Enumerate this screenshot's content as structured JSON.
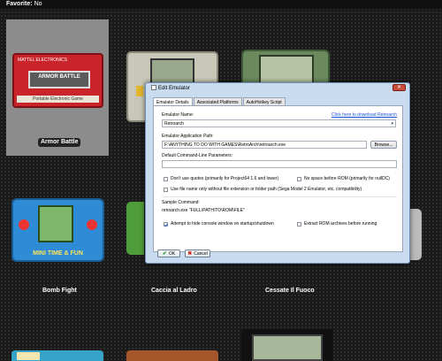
{
  "header": {
    "label": "Favorite:",
    "value": "No"
  },
  "games": {
    "selected": {
      "title": "Armor Battle",
      "artwork_brand": "MATTEL ELECTRONICS",
      "artwork_screen": "ARMOR BATTLE",
      "artwork_strip": "Portable Electronic Game"
    },
    "row2": [
      {
        "title": "Bomb Fight",
        "artwork_label": "MINI TIME & FUN"
      },
      {
        "title": "Caccia al Ladro"
      },
      {
        "title": "Cessate Il Fuoco"
      }
    ]
  },
  "dialog": {
    "title": "Edit Emulator",
    "close_label": "✕",
    "tabs": [
      "Emulator Details",
      "Associated Platforms",
      "AutoHotkey Script"
    ],
    "emulator_name_label": "Emulator Name:",
    "download_link": "Click here to download Retroarch",
    "emulator_name_value": "Retroarch",
    "app_path_label": "Emulator Application Path:",
    "app_path_value": "F:\\ANYTHING TO DO WITH GAMES\\RetroArch\\retroarch.exe",
    "browse_label": "Browse...",
    "cmd_params_label": "Default Command-Line Parameters:",
    "cmd_params_value": "",
    "options": [
      {
        "label": "Don't use quotes (primarily for Project64 1.6 and lower)",
        "checked": false
      },
      {
        "label": "No space before ROM (primarily for nullDC)",
        "checked": false
      },
      {
        "label": "Use file name only without file extension or folder path (Sega Model 2 Emulator, etc. compatibility)",
        "checked": false
      },
      {
        "label": "Attempt to hide console window on startup/shutdown",
        "checked": true
      },
      {
        "label": "Extract ROM archives before running",
        "checked": false
      }
    ],
    "sample_label": "Sample Command:",
    "sample_value": "retroarch.exe \"FULL\\PATH\\TO\\ROM\\FILE\"",
    "ok_label": "OK",
    "cancel_label": "Cancel"
  }
}
